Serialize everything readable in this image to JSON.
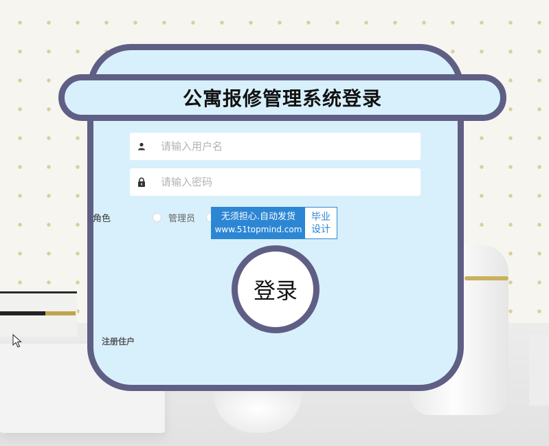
{
  "title": "公寓报修管理系统登录",
  "username_field": {
    "placeholder": "请输入用户名",
    "value": ""
  },
  "password_field": {
    "placeholder": "请输入密码",
    "value": ""
  },
  "role": {
    "label": "角色",
    "options": [
      "管理员"
    ]
  },
  "watermark": {
    "line1": "无须担心.自动发货",
    "line2": "www.51topmind.com",
    "side": [
      "毕业",
      "设计"
    ]
  },
  "login_label": "登录",
  "register_link": "注册住户",
  "colors": {
    "card_background": "#d8f0fc",
    "card_border": "#5f5f85",
    "badge_blue": "#2c86d4"
  }
}
